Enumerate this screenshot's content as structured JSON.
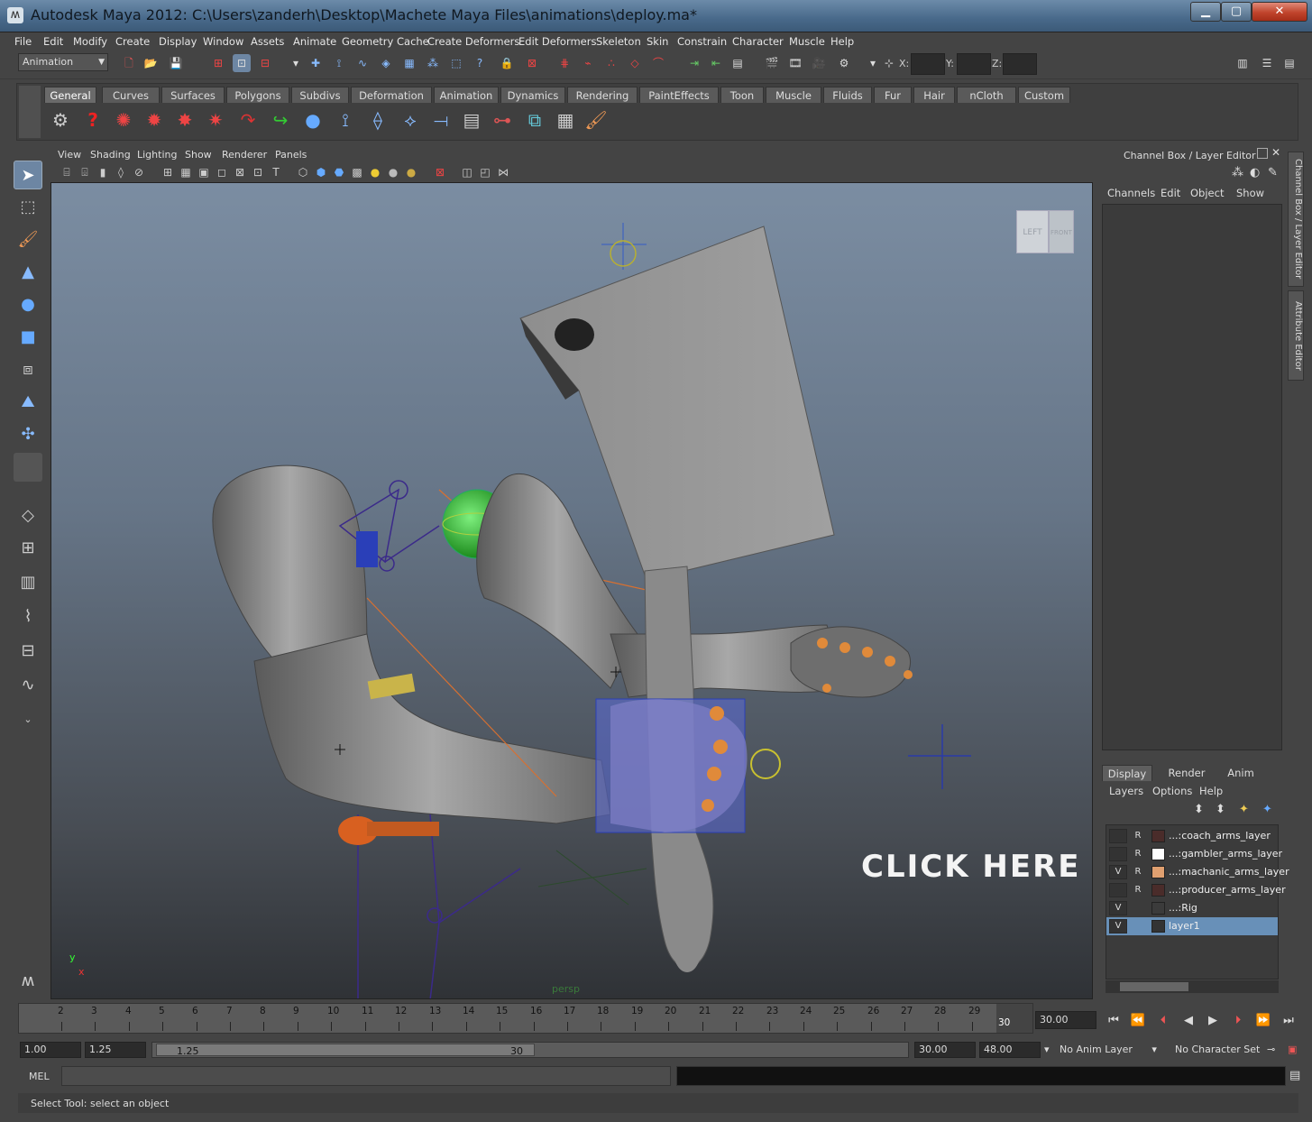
{
  "window": {
    "title": "Autodesk Maya 2012: C:\\Users\\zanderh\\Desktop\\Machete Maya Files\\animations\\deploy.ma*",
    "minimize": "▁",
    "maximize": "▢",
    "close": "✕"
  },
  "menubar": [
    "File",
    "Edit",
    "Modify",
    "Create",
    "Display",
    "Window",
    "Assets",
    "Animate",
    "Geometry Cache",
    "Create Deformers",
    "Edit Deformers",
    "Skeleton",
    "Skin",
    "Constrain",
    "Character",
    "Muscle",
    "Help"
  ],
  "status_line": {
    "mode": "Animation",
    "x_label": "X:",
    "y_label": "Y:",
    "z_label": "Z:"
  },
  "shelf": {
    "tabs": [
      "General",
      "Curves",
      "Surfaces",
      "Polygons",
      "Subdivs",
      "Deformation",
      "Animation",
      "Dynamics",
      "Rendering",
      "PaintEffects",
      "Toon",
      "Muscle",
      "Fluids",
      "Fur",
      "Hair",
      "nCloth",
      "Custom"
    ],
    "active_tab": "General"
  },
  "viewport": {
    "menu": [
      "View",
      "Shading",
      "Lighting",
      "Show",
      "Renderer",
      "Panels"
    ],
    "overlay_text": "CLICK HERE",
    "overlay_arrow": ">",
    "camera": "persp",
    "viewcube_left": "LEFT",
    "viewcube_front": "FRONT",
    "axis_y": "y",
    "axis_x": "x"
  },
  "channel_box": {
    "title": "Channel Box / Layer Editor",
    "menu": [
      "Channels",
      "Edit",
      "Object",
      "Show"
    ],
    "side_tab_channel": "Channel Box / Layer Editor",
    "side_tab_attr": "Attribute Editor"
  },
  "layer_editor": {
    "tabs": [
      "Display",
      "Render",
      "Anim"
    ],
    "active_tab": "Display",
    "menu": [
      "Layers",
      "Options",
      "Help"
    ],
    "layers": [
      {
        "v": "",
        "r": "R",
        "color": "#4a2c2a",
        "name": "...:coach_arms_layer",
        "selected": false
      },
      {
        "v": "",
        "r": "R",
        "color": "#ffffff",
        "name": "...:gambler_arms_layer",
        "selected": false
      },
      {
        "v": "V",
        "r": "R",
        "color": "#e0a070",
        "name": "...:machanic_arms_layer",
        "selected": false
      },
      {
        "v": "",
        "r": "R",
        "color": "#4a2c2a",
        "name": "...:producer_arms_layer",
        "selected": false
      },
      {
        "v": "V",
        "r": "",
        "color": "#3b3b3b",
        "name": "...:Rig",
        "selected": false
      },
      {
        "v": "V",
        "r": "",
        "color": "#6890b8",
        "name": "layer1",
        "selected": true
      }
    ]
  },
  "time_slider": {
    "ticks": [
      "2",
      "3",
      "4",
      "5",
      "6",
      "7",
      "8",
      "9",
      "10",
      "11",
      "12",
      "13",
      "14",
      "15",
      "16",
      "17",
      "18",
      "19",
      "20",
      "21",
      "22",
      "23",
      "24",
      "25",
      "26",
      "27",
      "28",
      "29",
      "30"
    ],
    "current_frame": "30",
    "current_time_field": "30.00"
  },
  "range_slider": {
    "start": "1.00",
    "playback_start": "1.25",
    "handle_in": "1.25",
    "handle_out": "30",
    "playback_end": "30.00",
    "end": "48.00",
    "anim_layer": "No Anim Layer",
    "character_set": "No Character Set"
  },
  "command_line": {
    "label": "MEL"
  },
  "help_line": "Select Tool: select an object"
}
